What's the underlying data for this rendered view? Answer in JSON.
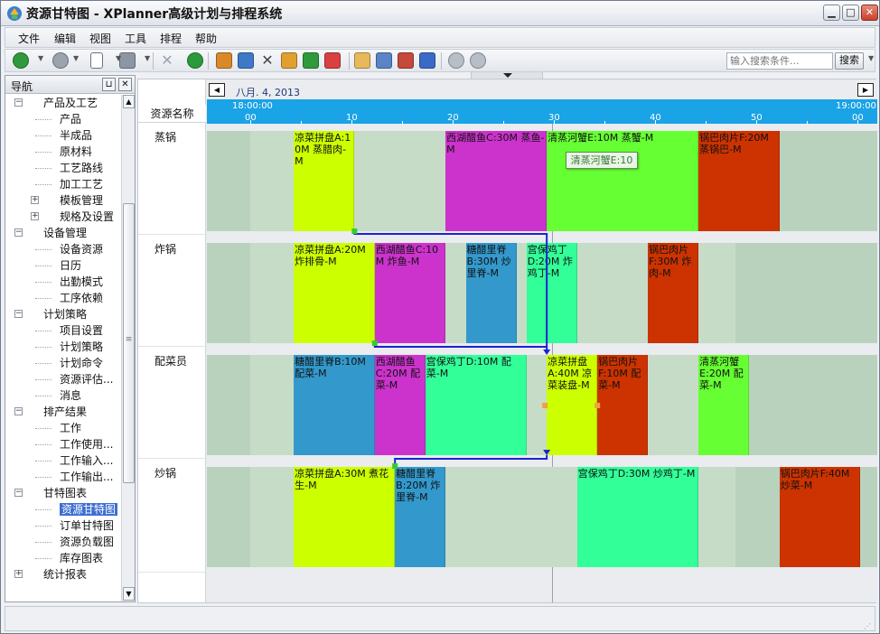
{
  "window": {
    "title": "资源甘特图 - XPlanner高级计划与排程系统",
    "btn_min": "▁",
    "btn_max": "□",
    "btn_close": "✕"
  },
  "menu": [
    "文件",
    "编辑",
    "视图",
    "工具",
    "排程",
    "帮助"
  ],
  "toolbar": {
    "search_placeholder": "输入搜索条件...",
    "search_label": "搜索"
  },
  "nav": {
    "title": "导航",
    "pin": "⊔",
    "close": "✕",
    "items": [
      {
        "label": "产品及工艺",
        "level": 0,
        "box": "−"
      },
      {
        "label": "产品",
        "level": 1
      },
      {
        "label": "半成品",
        "level": 1
      },
      {
        "label": "原材料",
        "level": 1
      },
      {
        "label": "工艺路线",
        "level": 1
      },
      {
        "label": "加工工艺",
        "level": 1
      },
      {
        "label": "模板管理",
        "level": 1,
        "box": "+"
      },
      {
        "label": "规格及设置",
        "level": 1,
        "box": "+"
      },
      {
        "label": "设备管理",
        "level": 0,
        "box": "−"
      },
      {
        "label": "设备资源",
        "level": 1
      },
      {
        "label": "日历",
        "level": 1
      },
      {
        "label": "出勤模式",
        "level": 1
      },
      {
        "label": "工序依赖",
        "level": 1
      },
      {
        "label": "计划策略",
        "level": 0,
        "box": "−"
      },
      {
        "label": "项目设置",
        "level": 1
      },
      {
        "label": "计划策略",
        "level": 1
      },
      {
        "label": "计划命令",
        "level": 1
      },
      {
        "label": "资源评估...",
        "level": 1
      },
      {
        "label": "消息",
        "level": 1
      },
      {
        "label": "排产结果",
        "level": 0,
        "box": "−"
      },
      {
        "label": "工作",
        "level": 1
      },
      {
        "label": "工作使用...",
        "level": 1
      },
      {
        "label": "工作输入...",
        "level": 1
      },
      {
        "label": "工作输出...",
        "level": 1
      },
      {
        "label": "甘特图表",
        "level": 0,
        "box": "−"
      },
      {
        "label": "资源甘特图",
        "level": 1,
        "selected": true
      },
      {
        "label": "订单甘特图",
        "level": 1
      },
      {
        "label": "资源负载图",
        "level": 1
      },
      {
        "label": "库存图表",
        "level": 1
      },
      {
        "label": "统计报表",
        "level": 0,
        "box": "+"
      }
    ]
  },
  "gantt": {
    "date": "八月. 4, 2013",
    "resource_header": "资源名称",
    "time_left": "18:00:00",
    "time_right": "19:00:00",
    "ticks": [
      "00",
      "10",
      "20",
      "30",
      "40",
      "50",
      "00"
    ],
    "resources": [
      "蒸锅",
      "炸锅",
      "配菜员",
      "炒锅"
    ],
    "tooltip": "清蒸河蟹E:10",
    "tasks": [
      {
        "row": 0,
        "start": 4.3,
        "end": 10.3,
        "color": "#ccff00",
        "text": "凉菜拼盘A:10M 蒸腊肉-M"
      },
      {
        "row": 0,
        "start": 19.3,
        "end": 29.3,
        "color": "#cc33cc",
        "text": "西湖醋鱼C:30M 蒸鱼-M"
      },
      {
        "row": 0,
        "start": 29.3,
        "end": 44.3,
        "color": "#66ff33",
        "text": "清蒸河蟹E:10M 蒸蟹-M"
      },
      {
        "row": 0,
        "start": 44.3,
        "end": 52.3,
        "color": "#cc3300",
        "text": "锅巴肉片F:20M 蒸锅巴-M"
      },
      {
        "row": 1,
        "start": 4.3,
        "end": 12.3,
        "color": "#ccff00",
        "text": "凉菜拼盘A:20M 炸排骨-M"
      },
      {
        "row": 1,
        "start": 12.3,
        "end": 19.3,
        "color": "#cc33cc",
        "text": "西湖醋鱼C:10M 炸鱼-M"
      },
      {
        "row": 1,
        "start": 21.3,
        "end": 26.3,
        "color": "#3399cc",
        "text": "糖醋里脊B:30M 炒里脊-M"
      },
      {
        "row": 1,
        "start": 27.3,
        "end": 32.3,
        "color": "#33ff99",
        "text": "宫保鸡丁D:20M 炸鸡丁-M"
      },
      {
        "row": 1,
        "start": 39.3,
        "end": 44.3,
        "color": "#cc3300",
        "text": "锅巴肉片F:30M 炸肉-M"
      },
      {
        "row": 2,
        "start": 4.3,
        "end": 12.3,
        "color": "#3399cc",
        "text": "糖醋里脊B:10M 配菜-M"
      },
      {
        "row": 2,
        "start": 12.3,
        "end": 17.3,
        "color": "#cc33cc",
        "text": "西湖醋鱼C:20M 配菜-M"
      },
      {
        "row": 2,
        "start": 17.3,
        "end": 27.3,
        "color": "#33ff99",
        "text": "宫保鸡丁D:10M 配菜-M"
      },
      {
        "row": 2,
        "start": 29.3,
        "end": 34.3,
        "color": "#ccff00",
        "text": "凉菜拼盘A:40M 凉菜装盘-M"
      },
      {
        "row": 2,
        "start": 34.3,
        "end": 39.3,
        "color": "#cc3300",
        "text": "锅巴肉片F:10M 配菜-M"
      },
      {
        "row": 2,
        "start": 44.3,
        "end": 49.3,
        "color": "#66ff33",
        "text": "清蒸河蟹E:20M 配菜-M"
      },
      {
        "row": 3,
        "start": 4.3,
        "end": 14.3,
        "color": "#ccff00",
        "text": "凉菜拼盘A:30M 煮花生-M"
      },
      {
        "row": 3,
        "start": 14.3,
        "end": 19.3,
        "color": "#3399cc",
        "text": "糖醋里脊B:20M 炸里脊-M"
      },
      {
        "row": 3,
        "start": 32.3,
        "end": 44.3,
        "color": "#33ff99",
        "text": "宫保鸡丁D:30M 炒鸡丁-M"
      },
      {
        "row": 3,
        "start": 52.3,
        "end": 60.3,
        "color": "#cc3300",
        "text": "锅巴肉片F:40M 炒菜-M"
      }
    ]
  }
}
